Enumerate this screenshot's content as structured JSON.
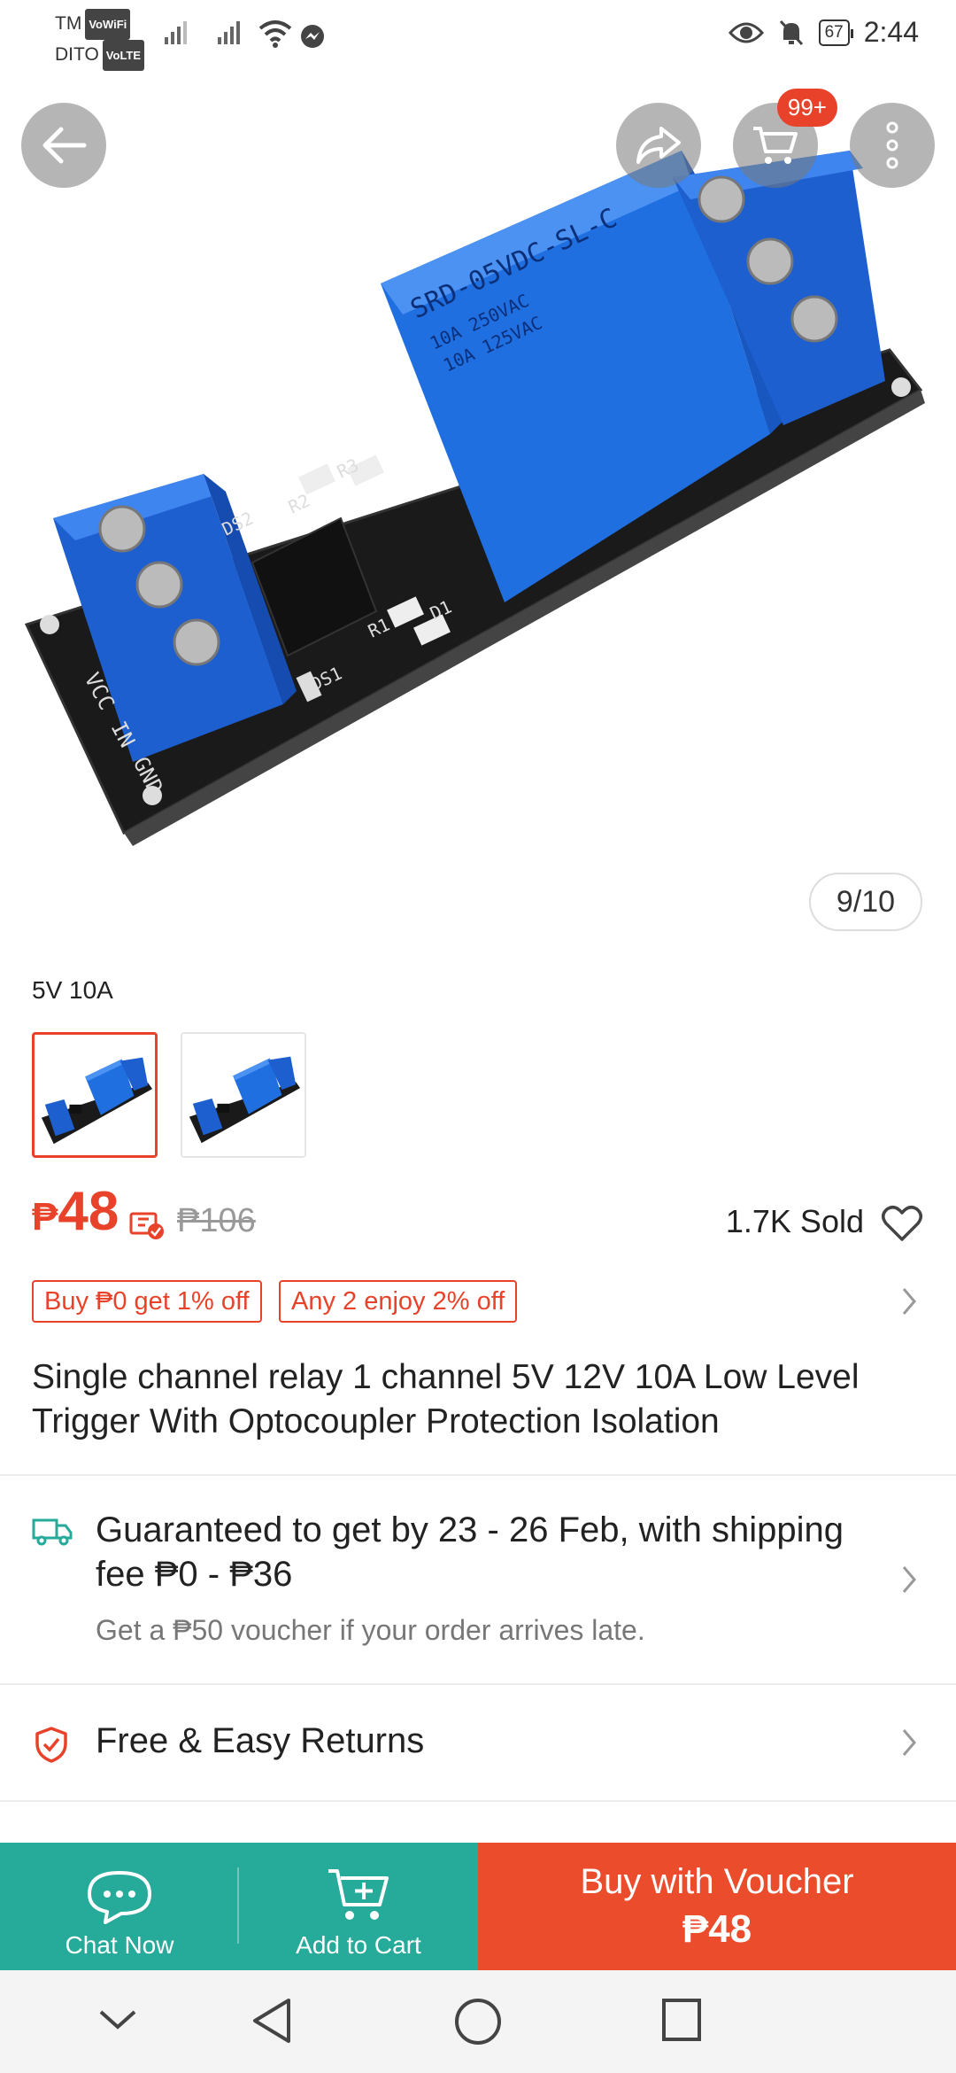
{
  "status_bar": {
    "carrier_1": "TM",
    "carrier_1_tag": "VoWiFi",
    "carrier_2": "DITO",
    "carrier_2_tag": "VoLTE",
    "battery": "67",
    "time": "2:44"
  },
  "hero": {
    "image_counter": "9/10",
    "cart_badge": "99+",
    "pcb_labels": {
      "vcc": "VCC",
      "in": "IN",
      "gnd": "GND",
      "relay_model": "SRD-05VDC-SL-C",
      "relay_rating_1": "10A 250VAC",
      "relay_rating_2": "10A 125VAC",
      "r1": "R1",
      "r2": "R2",
      "r3": "R3",
      "d1": "D1",
      "ds1": "DS1",
      "ds2": "DS2"
    }
  },
  "variant": {
    "label": "5V 10A"
  },
  "price": {
    "currency": "₱",
    "current": "48",
    "original": "₱106",
    "sold": "1.7K Sold"
  },
  "promos": [
    "Buy ₱0 get 1% off",
    "Any 2 enjoy 2% off"
  ],
  "product_title": "Single channel relay 1 channel  5V 12V 10A Low Level Trigger With Optocoupler Protection Isolation",
  "shipping": {
    "text": "Guaranteed to get by 23 - 26 Feb, with shipping fee ₱0 - ₱36",
    "voucher_note": "Get a ₱50 voucher if your order arrives late."
  },
  "returns": {
    "label": "Free & Easy Returns"
  },
  "action_bar": {
    "chat_label": "Chat Now",
    "cart_label": "Add to Cart",
    "buy_label": "Buy with Voucher",
    "buy_price": "₱48"
  },
  "colors": {
    "accent": "#e8432a",
    "teal": "#26aa99",
    "buy_bg": "#ea4c2c",
    "relay_blue": "#1f6fe0",
    "pcb_black": "#1a1a1a"
  },
  "icons": [
    "back-arrow-icon",
    "share-icon",
    "cart-icon",
    "more-icon",
    "heart-icon",
    "chevron-right-icon",
    "truck-icon",
    "shield-check-icon",
    "chat-icon",
    "add-cart-icon",
    "voucher-icon",
    "nav-down-icon",
    "nav-back-icon",
    "nav-home-icon",
    "nav-recent-icon"
  ]
}
